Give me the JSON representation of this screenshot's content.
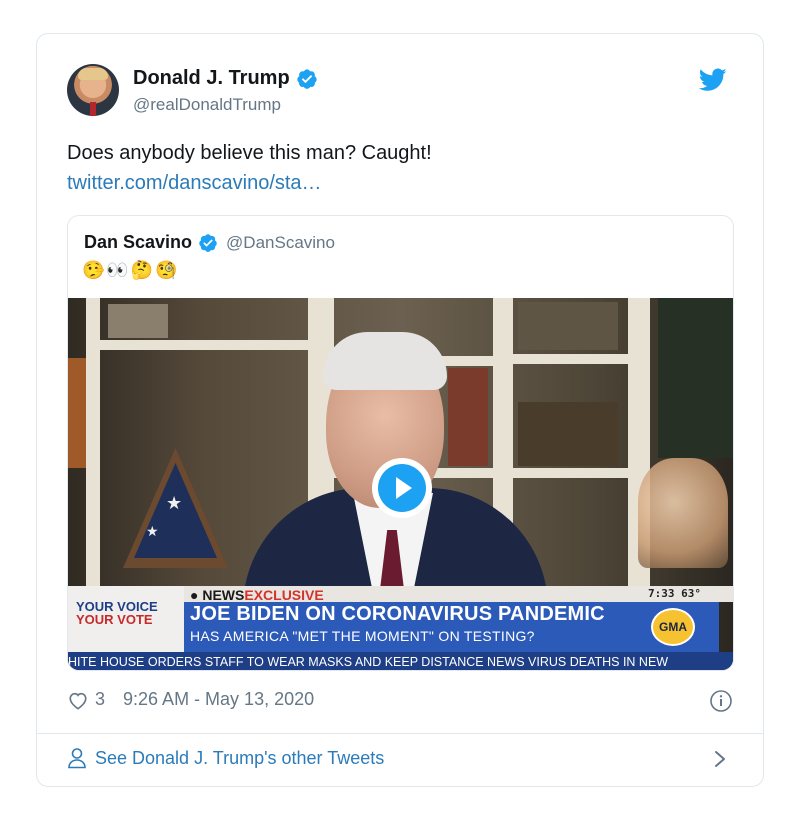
{
  "tweet": {
    "author_name": "Donald J. Trump",
    "author_handle": "@realDonaldTrump",
    "text": "Does anybody believe this man? Caught!",
    "link_text": "twitter.com/danscavino/sta…",
    "likes": "3",
    "timestamp": "9:26 AM - May 13, 2020"
  },
  "quoted_tweet": {
    "author_name": "Dan Scavino",
    "author_handle": "@DanScavino",
    "emoji_text": "🤥👀🤔🧐"
  },
  "video_overlay": {
    "badge_news": "NEWS",
    "badge_exclusive": "EXCLUSIVE",
    "clock": "7:33  63°",
    "your_voice_line1": "YOUR VOICE",
    "your_voice_line2": "YOUR VOTE",
    "headline": "JOE BIDEN ON CORONAVIRUS PANDEMIC",
    "subhead": "HAS AMERICA \"MET THE MOMENT\" ON TESTING?",
    "ticker": "HITE HOUSE ORDERS STAFF TO WEAR MASKS AND KEEP DISTANCE      NEWS   VIRUS DEATHS IN NEW",
    "network_logo": "GMA"
  },
  "footer": {
    "see_more": "See Donald J. Trump's other Tweets"
  },
  "colors": {
    "twitter_blue": "#1da1f2",
    "link_blue": "#2b7bb9",
    "secondary_text": "#657786",
    "border": "#e1e8ed"
  },
  "icons": [
    "verified-badge-icon",
    "twitter-bird-icon",
    "heart-icon",
    "info-icon",
    "user-icon",
    "chevron-right-icon",
    "play-icon"
  ]
}
